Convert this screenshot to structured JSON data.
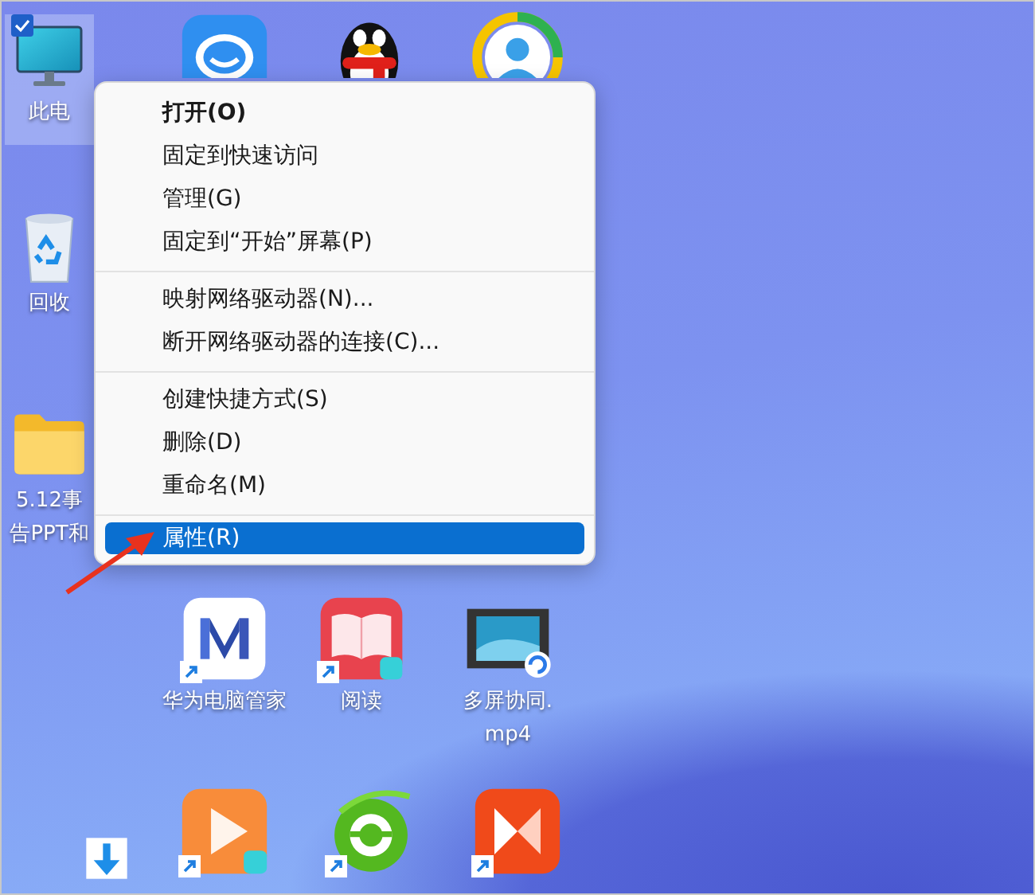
{
  "desktop": {
    "icons": [
      {
        "kind": "computer",
        "lines": [
          "此电"
        ],
        "selected": true,
        "shortcut": false
      },
      {
        "kind": "chat",
        "selected": false
      },
      {
        "kind": "penguin",
        "selected": false
      },
      {
        "kind": "ring",
        "selected": false
      },
      {
        "kind": "recycle-bin",
        "lines": [
          "回收"
        ],
        "selected": false,
        "shortcut": false
      },
      {
        "kind": "folder",
        "lines": [
          "5.12事",
          "告PPT和"
        ],
        "selected": false,
        "shortcut": false
      },
      {
        "kind": "m-logo",
        "lines": [
          "华为电脑管家"
        ],
        "selected": false,
        "shortcut": true
      },
      {
        "kind": "book",
        "lines": [
          "阅读"
        ],
        "selected": false,
        "shortcut": true
      },
      {
        "kind": "video-file",
        "lines": [
          "多屏协同.",
          "mp4"
        ],
        "selected": false,
        "shortcut": false
      },
      {
        "kind": "download",
        "selected": false,
        "shortcut": false
      },
      {
        "kind": "play",
        "selected": false,
        "shortcut": true
      },
      {
        "kind": "browser",
        "selected": false,
        "shortcut": true
      },
      {
        "kind": "bowtie",
        "selected": false,
        "shortcut": true
      }
    ]
  },
  "context_menu": {
    "items": [
      {
        "kind": "command",
        "label": "打开(O)",
        "bold": true,
        "selected": false
      },
      {
        "kind": "command",
        "label": "固定到快速访问",
        "bold": false,
        "selected": false
      },
      {
        "kind": "command",
        "label": "管理(G)",
        "bold": false,
        "selected": false
      },
      {
        "kind": "command",
        "label": "固定到“开始”屏幕(P)",
        "bold": false,
        "selected": false
      },
      {
        "kind": "separator"
      },
      {
        "kind": "command",
        "label": "映射网络驱动器(N)...",
        "bold": false,
        "selected": false
      },
      {
        "kind": "command",
        "label": "断开网络驱动器的连接(C)...",
        "bold": false,
        "selected": false
      },
      {
        "kind": "separator"
      },
      {
        "kind": "command",
        "label": "创建快捷方式(S)",
        "bold": false,
        "selected": false
      },
      {
        "kind": "command",
        "label": "删除(D)",
        "bold": false,
        "selected": false
      },
      {
        "kind": "command",
        "label": "重命名(M)",
        "bold": false,
        "selected": false
      },
      {
        "kind": "separator"
      },
      {
        "kind": "command",
        "label": "属性(R)",
        "bold": false,
        "selected": true
      }
    ]
  }
}
